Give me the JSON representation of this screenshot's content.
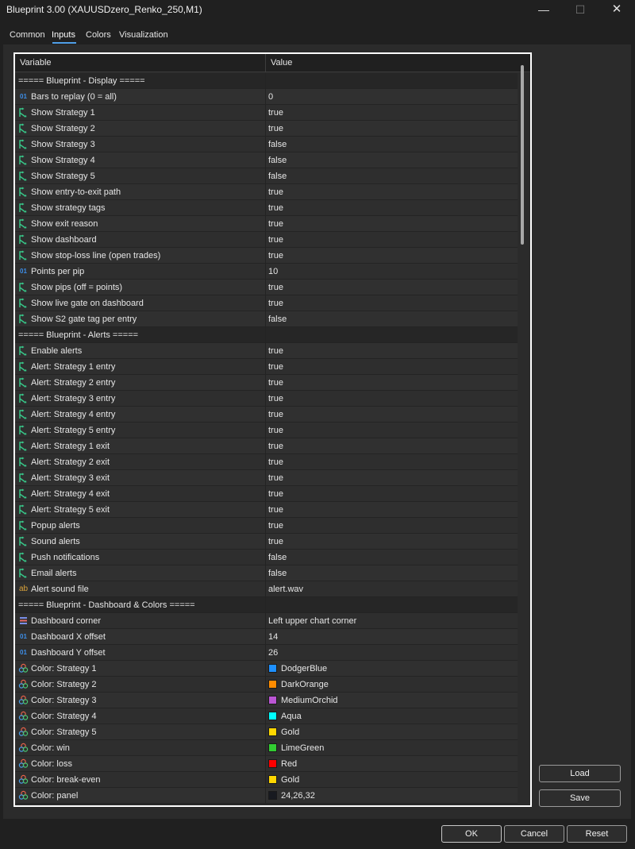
{
  "window": {
    "title": "Blueprint 3.00 (XAUUSDzero_Renko_250,M1)",
    "min_glyph": "—",
    "max_glyph": "☐",
    "close_glyph": "✕"
  },
  "tabs": [
    {
      "label": "Common"
    },
    {
      "label": "Inputs",
      "active": true
    },
    {
      "label": "Colors"
    },
    {
      "label": "Visualization"
    }
  ],
  "grid": {
    "col_variable": "Variable",
    "col_value": "Value",
    "rows": [
      {
        "type": "section",
        "name": "===== Blueprint  - Display =====",
        "value": ""
      },
      {
        "type": "num",
        "name": "Bars to replay (0 = all)",
        "value": "0"
      },
      {
        "type": "bool",
        "name": "Show Strategy 1",
        "value": "true"
      },
      {
        "type": "bool",
        "name": "Show Strategy 2",
        "value": "true"
      },
      {
        "type": "bool",
        "name": "Show Strategy 3",
        "value": "false"
      },
      {
        "type": "bool",
        "name": "Show Strategy 4",
        "value": "false"
      },
      {
        "type": "bool",
        "name": "Show Strategy 5",
        "value": "false"
      },
      {
        "type": "bool",
        "name": "Show entry-to-exit path",
        "value": "true"
      },
      {
        "type": "bool",
        "name": "Show strategy tags",
        "value": "true"
      },
      {
        "type": "bool",
        "name": "Show exit reason",
        "value": "true"
      },
      {
        "type": "bool",
        "name": "Show dashboard",
        "value": "true"
      },
      {
        "type": "bool",
        "name": "Show stop-loss line (open trades)",
        "value": "true"
      },
      {
        "type": "num",
        "name": "Points per pip",
        "value": "10"
      },
      {
        "type": "bool",
        "name": "Show pips (off = points)",
        "value": "true"
      },
      {
        "type": "bool",
        "name": "Show live gate on dashboard",
        "value": "true"
      },
      {
        "type": "bool",
        "name": "Show S2 gate tag per entry",
        "value": "false"
      },
      {
        "type": "section",
        "name": "===== Blueprint  - Alerts =====",
        "value": ""
      },
      {
        "type": "bool",
        "name": "Enable alerts",
        "value": "true"
      },
      {
        "type": "bool",
        "name": "Alert: Strategy 1 entry",
        "value": "true"
      },
      {
        "type": "bool",
        "name": "Alert: Strategy 2 entry",
        "value": "true"
      },
      {
        "type": "bool",
        "name": "Alert: Strategy 3 entry",
        "value": "true"
      },
      {
        "type": "bool",
        "name": "Alert: Strategy 4 entry",
        "value": "true"
      },
      {
        "type": "bool",
        "name": "Alert: Strategy 5 entry",
        "value": "true"
      },
      {
        "type": "bool",
        "name": "Alert: Strategy 1 exit",
        "value": "true"
      },
      {
        "type": "bool",
        "name": "Alert: Strategy 2 exit",
        "value": "true"
      },
      {
        "type": "bool",
        "name": "Alert: Strategy 3 exit",
        "value": "true"
      },
      {
        "type": "bool",
        "name": "Alert: Strategy 4 exit",
        "value": "true"
      },
      {
        "type": "bool",
        "name": "Alert: Strategy 5 exit",
        "value": "true"
      },
      {
        "type": "bool",
        "name": "Popup alerts",
        "value": "true"
      },
      {
        "type": "bool",
        "name": "Sound alerts",
        "value": "true"
      },
      {
        "type": "bool",
        "name": "Push notifications",
        "value": "false"
      },
      {
        "type": "bool",
        "name": "Email alerts",
        "value": "false"
      },
      {
        "type": "text",
        "name": "Alert sound file",
        "value": "alert.wav"
      },
      {
        "type": "section",
        "name": "===== Blueprint  - Dashboard & Colors =====",
        "value": ""
      },
      {
        "type": "enum",
        "name": "Dashboard corner",
        "value": "Left upper chart corner"
      },
      {
        "type": "num",
        "name": "Dashboard X offset",
        "value": "14"
      },
      {
        "type": "num",
        "name": "Dashboard Y offset",
        "value": "26"
      },
      {
        "type": "color",
        "name": "Color: Strategy 1",
        "value": "DodgerBlue",
        "swatch": "#1e90ff"
      },
      {
        "type": "color",
        "name": "Color: Strategy 2",
        "value": "DarkOrange",
        "swatch": "#ff8c00"
      },
      {
        "type": "color",
        "name": "Color: Strategy 3",
        "value": "MediumOrchid",
        "swatch": "#ba55d3"
      },
      {
        "type": "color",
        "name": "Color: Strategy 4",
        "value": "Aqua",
        "swatch": "#00ffff"
      },
      {
        "type": "color",
        "name": "Color: Strategy 5",
        "value": "Gold",
        "swatch": "#ffd700"
      },
      {
        "type": "color",
        "name": "Color: win",
        "value": "LimeGreen",
        "swatch": "#32cd32"
      },
      {
        "type": "color",
        "name": "Color: loss",
        "value": "Red",
        "swatch": "#ff0000"
      },
      {
        "type": "color",
        "name": "Color: break-even",
        "value": "Gold",
        "swatch": "#ffd700"
      },
      {
        "type": "color",
        "name": "Color: panel",
        "value": "24,26,32",
        "swatch": "#181a20"
      }
    ]
  },
  "side_buttons": {
    "load": "Load",
    "save": "Save"
  },
  "footer": {
    "ok": "OK",
    "cancel": "Cancel",
    "reset": "Reset"
  },
  "icons": {
    "bool": "bool-arrow-icon",
    "num": "number-icon",
    "text": "text-ab-icon",
    "enum": "list-enum-icon",
    "color": "color-palette-icon"
  },
  "colors": {
    "accent": "#4f9fe8",
    "bool_icon": "#38c98a",
    "num_icon": "#3d8ee8",
    "text_icon": "#d9a23a"
  }
}
